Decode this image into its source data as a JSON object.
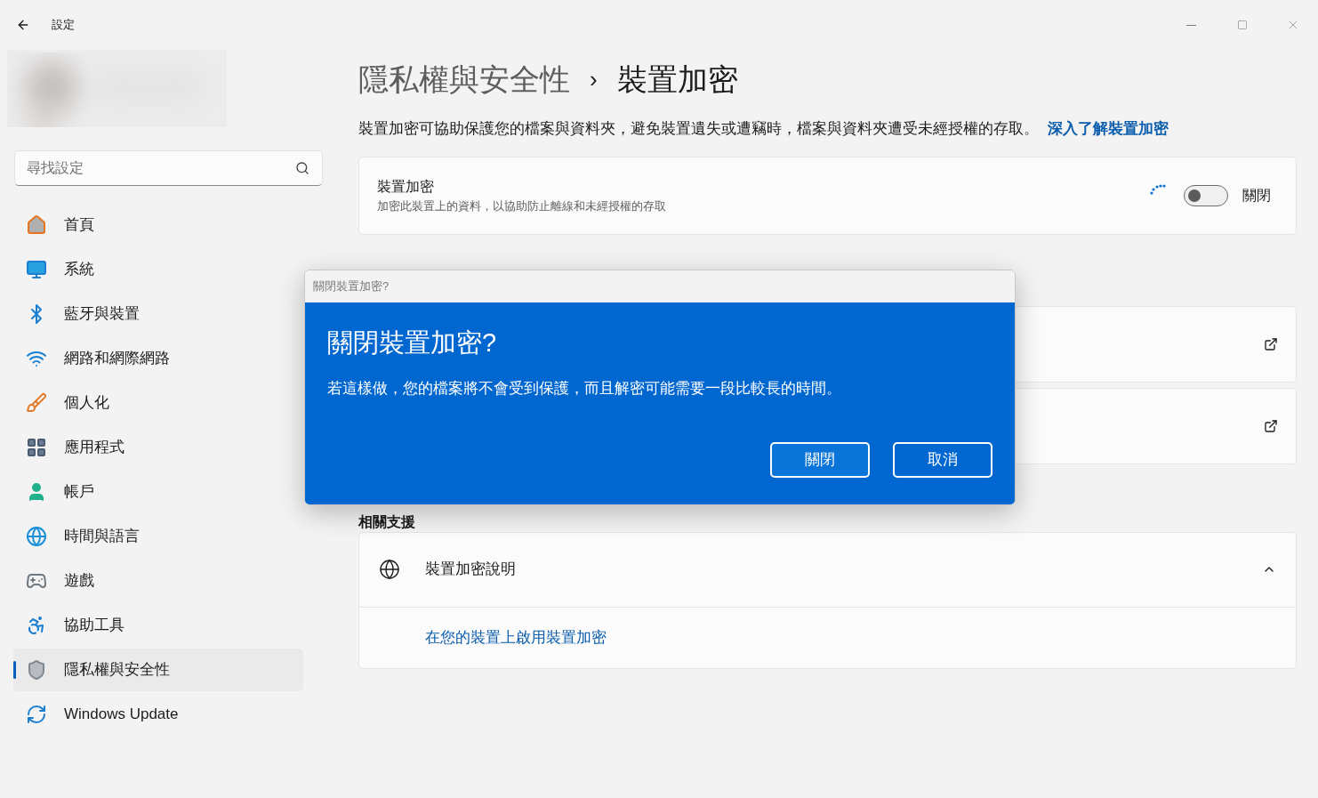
{
  "window": {
    "title": "設定"
  },
  "sidebar": {
    "search": {
      "placeholder": "尋找設定"
    },
    "items": [
      {
        "label": "首頁",
        "selected": false
      },
      {
        "label": "系統",
        "selected": false
      },
      {
        "label": "藍牙與裝置",
        "selected": false
      },
      {
        "label": "網路和網際網路",
        "selected": false
      },
      {
        "label": "個人化",
        "selected": false
      },
      {
        "label": "應用程式",
        "selected": false
      },
      {
        "label": "帳戶",
        "selected": false
      },
      {
        "label": "時間與語言",
        "selected": false
      },
      {
        "label": "遊戲",
        "selected": false
      },
      {
        "label": "協助工具",
        "selected": false
      },
      {
        "label": "隱私權與安全性",
        "selected": true
      },
      {
        "label": "Windows Update",
        "selected": false
      }
    ]
  },
  "breadcrumb": [
    "隱私權與安全性",
    "›",
    "裝置加密"
  ],
  "description": {
    "text": "裝置加密可協助保護您的檔案與資料夾，避免裝置遺失或遭竊時，檔案與資料夾遭受未經授權的存取。",
    "link": "深入了解裝置加密"
  },
  "encryption_card": {
    "title": "裝置加密",
    "subtitle": "加密此裝置上的資料，以協助防止離線和未經授權的存取",
    "busy": true,
    "toggle": {
      "on": false,
      "label": "關閉"
    }
  },
  "related_support": {
    "heading": "相關支援",
    "item": {
      "label": "裝置加密說明",
      "expanded": true,
      "link": "在您的裝置上啟用裝置加密"
    }
  },
  "dialog": {
    "caption": "關閉裝置加密?",
    "title": "關閉裝置加密?",
    "message": "若這樣做，您的檔案將不會受到保護，而且解密可能需要一段比較長的時間。",
    "buttons": [
      {
        "label": "關閉",
        "default": true
      },
      {
        "label": "取消",
        "default": false
      }
    ]
  }
}
